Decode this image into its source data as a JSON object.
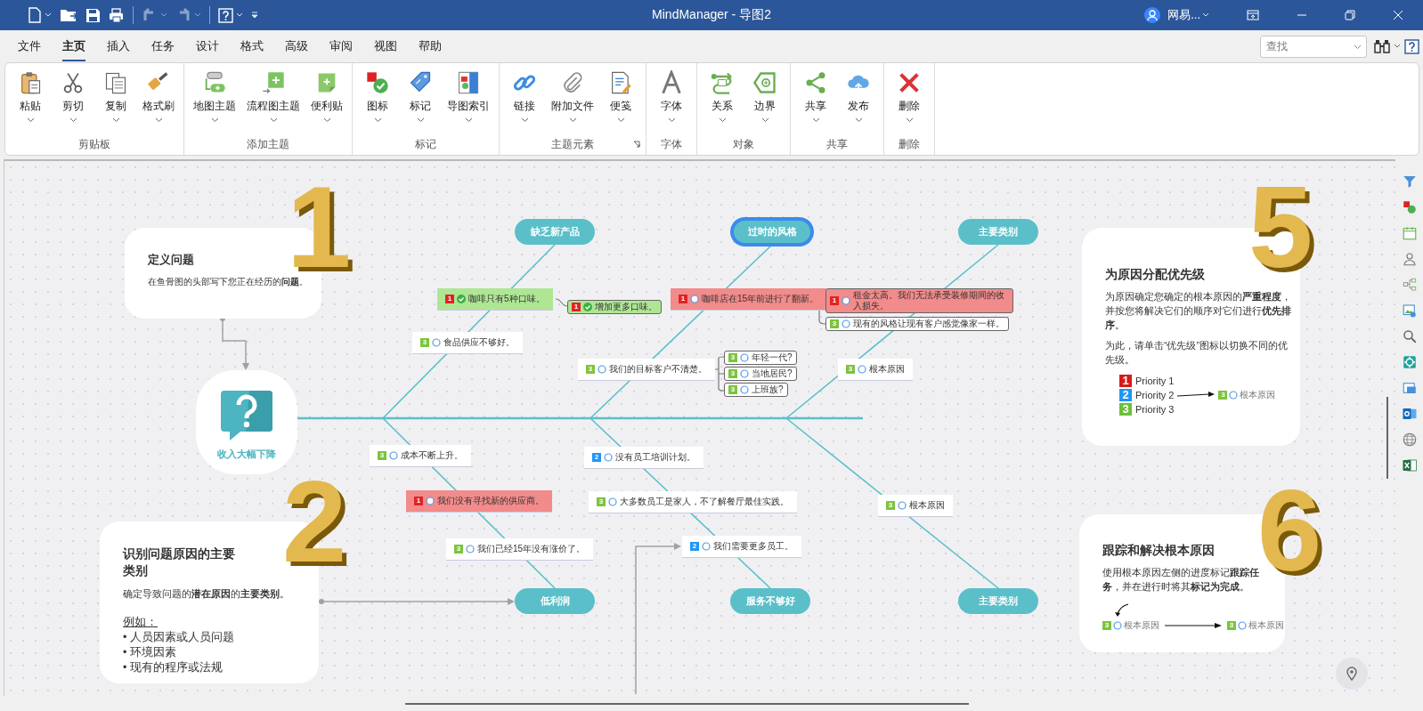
{
  "window": {
    "title": "MindManager - 导图2",
    "user": "网易..."
  },
  "tabs": [
    {
      "label": "文件",
      "selected": false
    },
    {
      "label": "主页",
      "selected": true
    },
    {
      "label": "插入",
      "selected": false
    },
    {
      "label": "任务",
      "selected": false
    },
    {
      "label": "设计",
      "selected": false
    },
    {
      "label": "格式",
      "selected": false
    },
    {
      "label": "高级",
      "selected": false
    },
    {
      "label": "审阅",
      "selected": false
    },
    {
      "label": "视图",
      "selected": false
    },
    {
      "label": "帮助",
      "selected": false
    }
  ],
  "search": {
    "placeholder": "查找"
  },
  "ribbon": [
    {
      "label": "剪贴板",
      "launcher": false,
      "buttons": [
        {
          "kind": "paste",
          "label": "粘贴"
        },
        {
          "kind": "cut",
          "label": "剪切"
        },
        {
          "kind": "copy",
          "label": "复制"
        },
        {
          "kind": "painter",
          "label": "格式刷"
        }
      ]
    },
    {
      "label": "添加主题",
      "launcher": false,
      "buttons": [
        {
          "kind": "maptopic",
          "label": "地图主题"
        },
        {
          "kind": "flowtopic",
          "label": "流程图主题"
        },
        {
          "kind": "sticky",
          "label": "便利贴"
        }
      ]
    },
    {
      "label": "标记",
      "launcher": false,
      "buttons": [
        {
          "kind": "icons",
          "label": "图标"
        },
        {
          "kind": "tag",
          "label": "标记"
        },
        {
          "kind": "index",
          "label": "导图索引"
        }
      ]
    },
    {
      "label": "主题元素",
      "launcher": true,
      "buttons": [
        {
          "kind": "link",
          "label": "链接"
        },
        {
          "kind": "attach",
          "label": "附加文件"
        },
        {
          "kind": "note",
          "label": "便笺"
        }
      ]
    },
    {
      "label": "字体",
      "launcher": false,
      "buttons": [
        {
          "kind": "font",
          "label": "字体"
        }
      ]
    },
    {
      "label": "对象",
      "launcher": false,
      "buttons": [
        {
          "kind": "relation",
          "label": "关系"
        },
        {
          "kind": "boundary",
          "label": "边界"
        }
      ]
    },
    {
      "label": "共享",
      "launcher": false,
      "buttons": [
        {
          "kind": "share",
          "label": "共享"
        },
        {
          "kind": "publish",
          "label": "发布"
        }
      ]
    },
    {
      "label": "删除",
      "launcher": false,
      "buttons": [
        {
          "kind": "delete",
          "label": "删除"
        }
      ]
    }
  ],
  "map": {
    "central_topic": "收入大幅下降",
    "categories": [
      {
        "label": "缺乏新产品",
        "selected": false
      },
      {
        "label": "过时的风格",
        "selected": true
      },
      {
        "label": "主要类别",
        "selected": false
      },
      {
        "label": "低利润",
        "selected": false
      },
      {
        "label": "服务不够好",
        "selected": false
      },
      {
        "label": "主要类别",
        "selected": false
      }
    ],
    "topics": [
      {
        "kind": "callout",
        "text": "咖啡只有5种口味。",
        "priority": {
          "label": "1",
          "color": "#e02424"
        },
        "done": true,
        "color": "#aee694"
      },
      {
        "kind": "subtopic",
        "text": "增加更多口味。",
        "priority": {
          "label": "1",
          "color": "#e02424"
        },
        "done": true,
        "color": "#aee694"
      },
      {
        "kind": "callout",
        "text": "食品供应不够好。",
        "priority": {
          "label": "3",
          "color": "#7cc43c"
        },
        "done": false
      },
      {
        "kind": "callout",
        "text": "咖啡店在15年前进行了翻新。",
        "priority": {
          "label": "1",
          "color": "#e02424"
        },
        "done": false,
        "color": "#f28b8b"
      },
      {
        "kind": "subtopic",
        "text": "租金太高。我们无法承受装修期间的收入损失。",
        "priority": {
          "label": "1",
          "color": "#e02424"
        },
        "done": false,
        "color": "#f28b8b"
      },
      {
        "kind": "subtopic",
        "text": "现有的风格让现有客户感觉像家一样。",
        "priority": {
          "label": "3",
          "color": "#7cc43c"
        },
        "done": false
      },
      {
        "kind": "callout",
        "text": "我们的目标客户不清楚。",
        "priority": {
          "label": "3",
          "color": "#7cc43c"
        },
        "done": false
      },
      {
        "kind": "subtopic",
        "text": "年轻一代?",
        "priority": {
          "label": "3",
          "color": "#7cc43c"
        },
        "done": false
      },
      {
        "kind": "subtopic",
        "text": "当地居民?",
        "priority": {
          "label": "3",
          "color": "#7cc43c"
        },
        "done": false
      },
      {
        "kind": "subtopic",
        "text": "上班族?",
        "priority": {
          "label": "3",
          "color": "#7cc43c"
        },
        "done": false
      },
      {
        "kind": "callout",
        "text": "根本原因",
        "priority": {
          "label": "3",
          "color": "#7cc43c"
        },
        "done": false
      },
      {
        "kind": "callout",
        "text": "成本不断上升。",
        "priority": {
          "label": "3",
          "color": "#7cc43c"
        },
        "done": false
      },
      {
        "kind": "callout",
        "text": "我们没有寻找新的供应商。",
        "priority": {
          "label": "1",
          "color": "#e02424"
        },
        "done": false,
        "color": "#f28b8b"
      },
      {
        "kind": "callout",
        "text": "我们已经15年没有涨价了。",
        "priority": {
          "label": "3",
          "color": "#7cc43c"
        },
        "done": false
      },
      {
        "kind": "callout",
        "text": "没有员工培训计划。",
        "priority": {
          "label": "2",
          "color": "#2196f3"
        },
        "done": false
      },
      {
        "kind": "callout",
        "text": "大多数员工是家人，不了解餐厅最佳实践。",
        "priority": {
          "label": "3",
          "color": "#7cc43c"
        },
        "done": false
      },
      {
        "kind": "callout",
        "text": "我们需要更多员工。",
        "priority": {
          "label": "2",
          "color": "#2196f3"
        },
        "done": false
      },
      {
        "kind": "callout",
        "text": "根本原因",
        "priority": {
          "label": "3",
          "color": "#7cc43c"
        },
        "done": false
      }
    ],
    "cards": [
      {
        "number": "1",
        "title": "定义问题",
        "paragraphs": [
          "在鱼骨图的头部写下您正在经历的**问题**。"
        ]
      },
      {
        "number": "2",
        "title": "识别问题原因的主要类别",
        "paragraphs": [
          "确定导致问题的**潜在原因**的**主要类别**。"
        ],
        "example": {
          "heading": "例如：",
          "items": [
            "• 人员因素或人员问题",
            "• 环境因素",
            "• 现有的程序或法规"
          ]
        }
      },
      {
        "number": "5",
        "title": "为原因分配优先级",
        "paragraphs": [
          "为原因确定您确定的根本原因的**严重程度**，并按您将解决它们的顺序对它们进行**优先排序**。",
          "为此，请单击“优先级”图标以切换不同的优先级。"
        ],
        "legend": {
          "priorities": [
            {
              "label": "1",
              "color": "#d71a1a",
              "text": "Priority 1"
            },
            {
              "label": "2",
              "color": "#2196f3",
              "text": "Priority 2"
            },
            {
              "label": "3",
              "color": "#6cbf3a",
              "text": "Priority 3"
            }
          ],
          "target": {
            "text": "根本原因",
            "priority": {
              "label": "3",
              "color": "#7cc43c"
            },
            "done": false
          }
        }
      },
      {
        "number": "6",
        "title": "跟踪和解决根本原因",
        "paragraphs": [
          "使用根本原因左侧的进度标记**跟踪任务**，并在进行时将其**标记为完成**。"
        ],
        "demo": [
          {
            "text": "根本原因",
            "priority": {
              "label": "3",
              "color": "#7cc43c"
            },
            "done": false
          },
          {
            "text": "根本原因",
            "priority": {
              "label": "3",
              "color": "#7cc43c"
            },
            "done": false
          }
        ]
      }
    ]
  }
}
